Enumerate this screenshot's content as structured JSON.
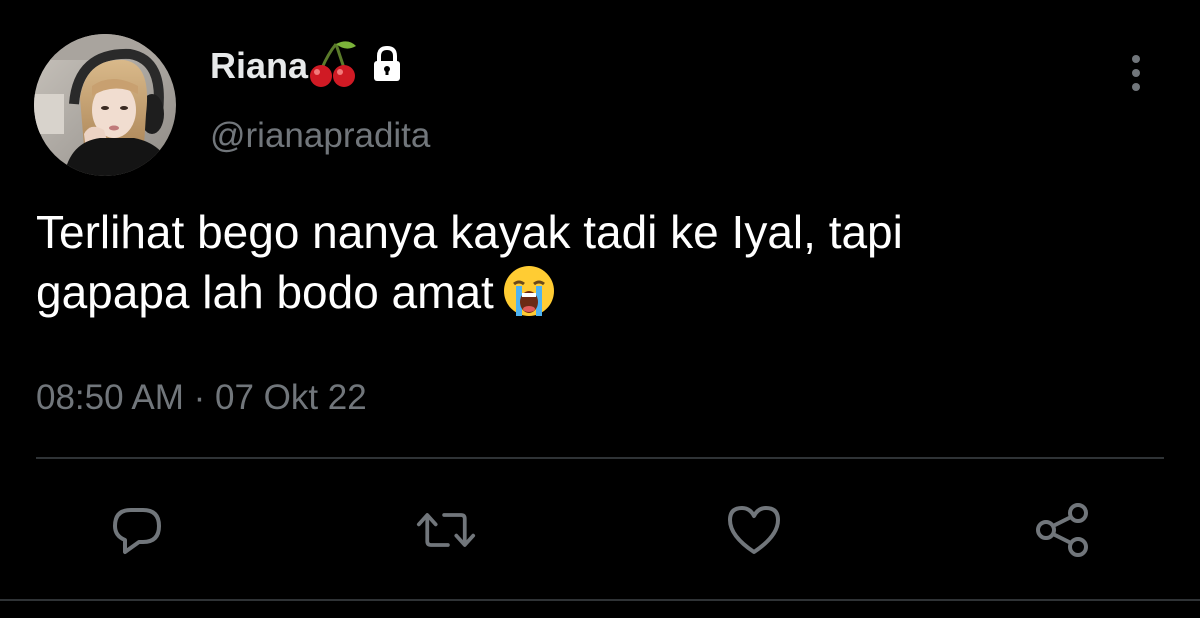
{
  "author": {
    "display_name": "Riana",
    "name_emoji_icon": "cherries-icon",
    "protected_icon": "lock-icon",
    "username": "@rianapradita",
    "avatar_icon": "profile-photo"
  },
  "tweet": {
    "text_line1": "Terlihat bego nanya kayak tadi ke Iyal, tapi",
    "text_line2": "gapapa lah bodo amat",
    "emoji_icon": "loudly-crying-face-icon",
    "timestamp": "08:50 AM · 07 Okt 22"
  },
  "actions": [
    {
      "name": "reply",
      "icon": "reply-icon"
    },
    {
      "name": "retweet",
      "icon": "retweet-icon"
    },
    {
      "name": "like",
      "icon": "heart-icon"
    },
    {
      "name": "share",
      "icon": "share-icon"
    }
  ],
  "colors": {
    "background": "#000000",
    "primary_text": "#e7e9ea",
    "secondary_text": "#71767b",
    "icon": "#71767b",
    "divider": "#2f3336"
  }
}
